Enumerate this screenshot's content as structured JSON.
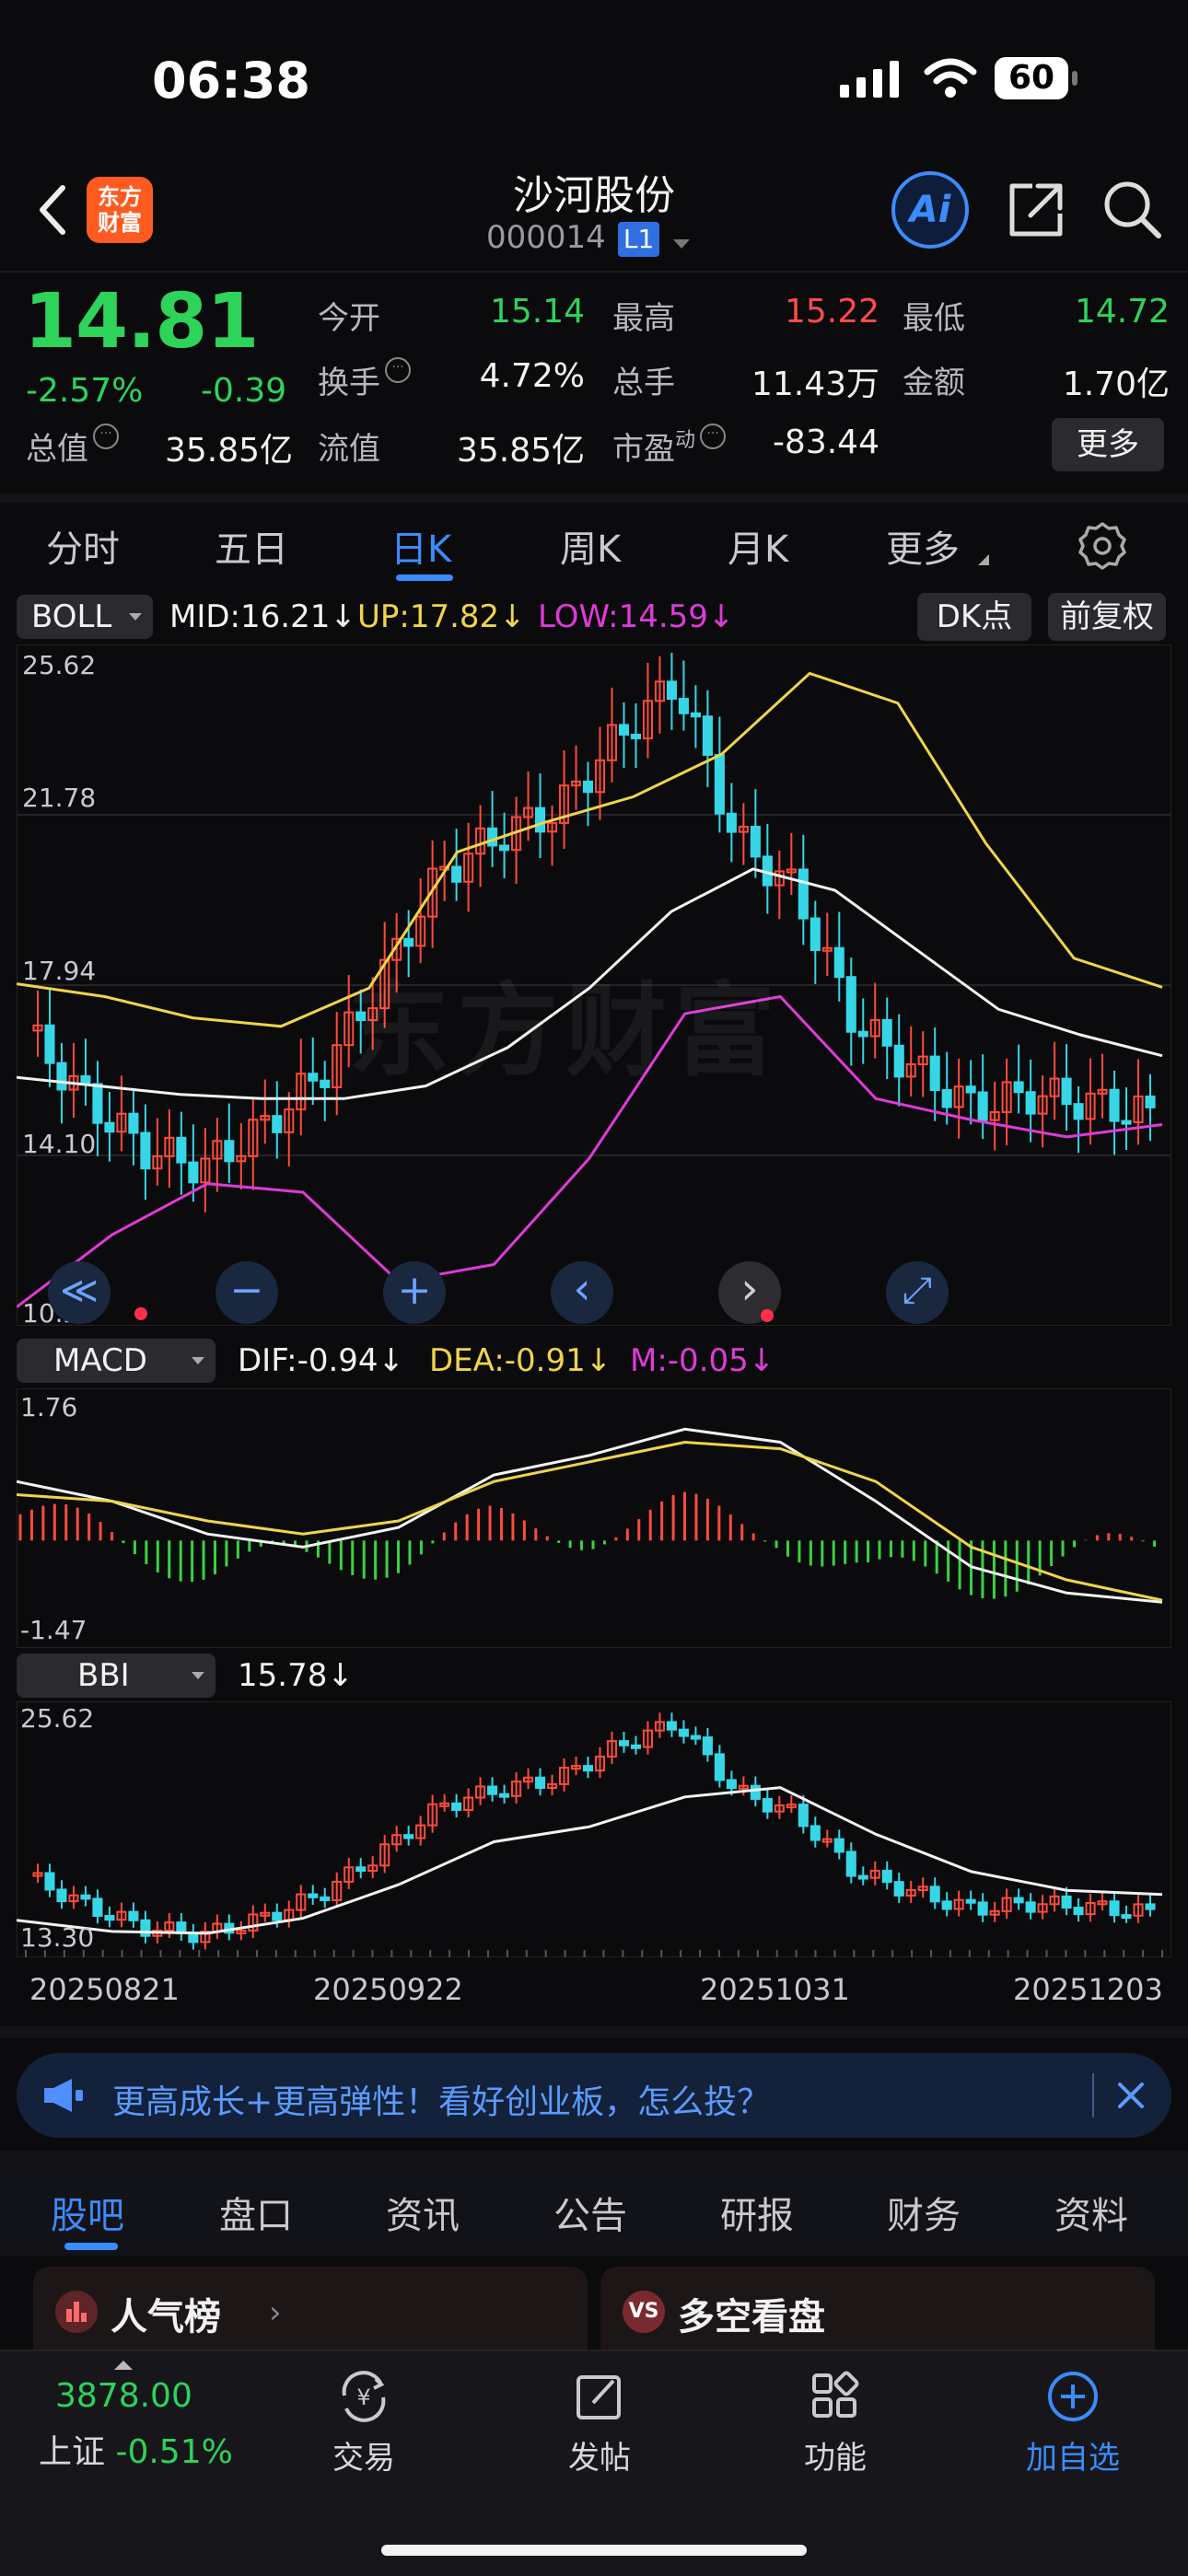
{
  "status_bar": {
    "time": "06:38",
    "battery": "60"
  },
  "header": {
    "back_icon": "back-chevron-icon",
    "logo_text": "东方\n财富",
    "title": "沙河股份",
    "code": "000014",
    "level_badge": "L1",
    "ai_label": "Ai",
    "share_icon": "share-icon",
    "search_icon": "search-icon"
  },
  "quote": {
    "price": "14.81",
    "change_pct": "-2.57%",
    "change_abs": "-0.39",
    "items": [
      {
        "label": "今开",
        "value": "15.14",
        "color": "#2ed35a"
      },
      {
        "label": "最高",
        "value": "15.22",
        "color": "#ff4b4b"
      },
      {
        "label": "最低",
        "value": "14.72",
        "color": "#2ed35a"
      },
      {
        "label": "换手",
        "value": "4.72%",
        "color": "#f2f2f2"
      },
      {
        "label": "总手",
        "value": "11.43万",
        "color": "#f2f2f2"
      },
      {
        "label": "金额",
        "value": "1.70亿",
        "color": "#f2f2f2"
      },
      {
        "label": "总值",
        "value": "35.85亿",
        "color": "#f2f2f2"
      },
      {
        "label": "流值",
        "value": "35.85亿",
        "color": "#f2f2f2"
      },
      {
        "label": "市盈",
        "superscript": "动",
        "value": "-83.44",
        "color": "#f2f2f2"
      }
    ],
    "more_button": "更多"
  },
  "period_tabs": [
    "分时",
    "五日",
    "日K",
    "周K",
    "月K",
    "更多"
  ],
  "active_period": "日K",
  "settings_icon": "gear-icon",
  "boll": {
    "indicator": "BOLL",
    "mid": "MID:16.21↓",
    "up": "UP:17.82↓",
    "low": "LOW:14.59↓",
    "dk_label": "DK点",
    "adjust_label": "前复权",
    "axis": [
      "25.62",
      "21.78",
      "17.94",
      "14.10",
      "10.25"
    ],
    "watermark": "东方财富"
  },
  "chart_controls": [
    {
      "name": "rewind-icon",
      "glyph": "≪"
    },
    {
      "name": "zoom-out-icon",
      "glyph": "−"
    },
    {
      "name": "zoom-in-icon",
      "glyph": "+"
    },
    {
      "name": "prev-icon",
      "glyph": "‹"
    },
    {
      "name": "next-icon",
      "glyph": "›"
    },
    {
      "name": "fullscreen-icon",
      "glyph": "⤢"
    }
  ],
  "macd": {
    "indicator": "MACD",
    "dif": "DIF:-0.94↓",
    "dea": "DEA:-0.91↓",
    "m": "M:-0.05↓",
    "axis": [
      "1.76",
      "-1.47"
    ]
  },
  "bbi": {
    "indicator": "BBI",
    "value": "15.78↓",
    "axis": [
      "25.62",
      "13.30"
    ]
  },
  "date_axis": [
    "20250821",
    "20250922",
    "20251031",
    "20251203"
  ],
  "banner": {
    "text": "更高成长+更高弹性！看好创业板，怎么投？"
  },
  "section_tabs": [
    "股吧",
    "盘口",
    "资讯",
    "公告",
    "研报",
    "财务",
    "资料"
  ],
  "active_section": "股吧",
  "cards": [
    {
      "title": "人气榜"
    },
    {
      "title": "多空看盘"
    }
  ],
  "bottom_nav": {
    "index_value": "3878.00",
    "index_name": "上证",
    "index_change": "-0.51%",
    "items": [
      {
        "label": "交易",
        "icon": "yen-exchange-icon"
      },
      {
        "label": "发帖",
        "icon": "edit-icon"
      },
      {
        "label": "功能",
        "icon": "grid-icon"
      },
      {
        "label": "加自选",
        "icon": "plus-circle-icon"
      }
    ]
  },
  "chart_data": [
    {
      "type": "candlestick",
      "title": "BOLL",
      "ylim": [
        10.25,
        25.62
      ],
      "series": [
        {
          "name": "MID",
          "values": [
            15.7,
            15.5,
            15.3,
            15.2,
            15.2,
            15.5,
            16.4,
            17.8,
            19.6,
            20.6,
            20.1,
            18.7,
            17.3,
            16.7,
            16.21
          ]
        },
        {
          "name": "UP",
          "values": [
            17.9,
            17.6,
            17.1,
            16.9,
            17.8,
            21.0,
            21.7,
            22.3,
            23.3,
            25.2,
            24.5,
            21.2,
            18.5,
            17.82
          ]
        },
        {
          "name": "LOW",
          "values": [
            10.3,
            12.0,
            13.2,
            13.0,
            10.9,
            11.3,
            13.8,
            17.2,
            17.6,
            15.2,
            14.7,
            14.3,
            14.59
          ]
        }
      ],
      "close_approx": [
        16.8,
        15.2,
        14.0,
        13.6,
        14.5,
        15.8,
        18.0,
        20.5,
        21.4,
        22.0,
        23.7,
        25.0,
        21.3,
        20.1,
        17.0,
        15.9,
        15.0,
        15.3,
        15.1,
        14.81
      ]
    },
    {
      "type": "bar",
      "title": "MACD",
      "ylim": [
        -1.47,
        1.76
      ],
      "series": [
        {
          "name": "DIF",
          "values": [
            0.9,
            0.6,
            0.1,
            -0.1,
            0.2,
            1.0,
            1.3,
            1.7,
            1.5,
            0.6,
            -0.4,
            -0.8,
            -0.94
          ]
        },
        {
          "name": "DEA",
          "values": [
            0.7,
            0.6,
            0.3,
            0.1,
            0.3,
            0.9,
            1.2,
            1.5,
            1.4,
            0.9,
            -0.1,
            -0.6,
            -0.91
          ]
        }
      ]
    },
    {
      "type": "candlestick",
      "title": "BBI",
      "ylim": [
        13.3,
        25.62
      ],
      "series": [
        {
          "name": "BBI",
          "values": [
            14.4,
            13.8,
            13.7,
            14.5,
            16.3,
            18.6,
            19.4,
            21.0,
            21.5,
            19.0,
            17.0,
            16.0,
            15.78
          ]
        }
      ]
    }
  ]
}
